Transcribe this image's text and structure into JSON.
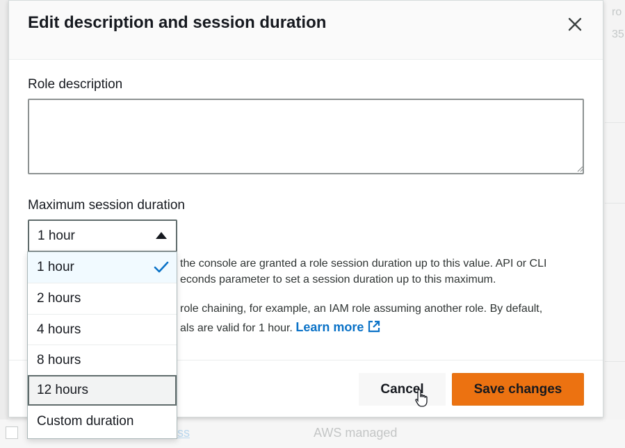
{
  "modal": {
    "title": "Edit description and session duration",
    "close_icon": "close-icon"
  },
  "role_description": {
    "label": "Role description",
    "value": "",
    "placeholder": ""
  },
  "session_duration": {
    "label": "Maximum session duration",
    "selected": "1 hour",
    "options": [
      {
        "label": "1 hour",
        "state": "selected"
      },
      {
        "label": "2 hours",
        "state": "normal"
      },
      {
        "label": "4 hours",
        "state": "normal"
      },
      {
        "label": "8 hours",
        "state": "normal"
      },
      {
        "label": "12 hours",
        "state": "hovered"
      },
      {
        "label": "Custom duration",
        "state": "normal"
      }
    ]
  },
  "help": {
    "line1": "the console are granted a role session duration up to this value. API or CLI",
    "line2": "econds parameter to set a session duration up to this maximum.",
    "line3": "role chaining, for example, an IAM role assuming another role. By default,",
    "line4": "als are valid for 1 hour.",
    "learn_more": "Learn more",
    "external_icon": "external-link-icon"
  },
  "footer": {
    "cancel_label": "Cancel",
    "save_label": "Save changes"
  },
  "background": {
    "right_line1": "ro",
    "right_line2": "35",
    "table_cell_link": "ss",
    "table_cell_type": "AWS managed"
  },
  "colors": {
    "primary_button": "#ec7211",
    "link": "#0a72c7",
    "selected_option_bg": "#f1faff",
    "check": "#0a72c7"
  }
}
